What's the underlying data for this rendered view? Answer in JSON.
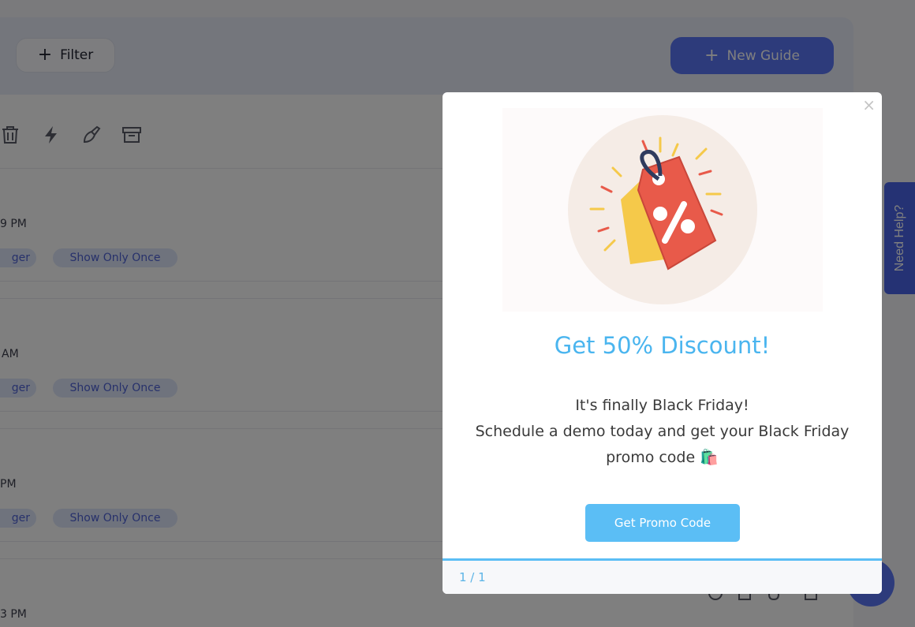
{
  "header": {
    "filter_label": "Filter",
    "new_guide_label": "New Guide"
  },
  "toolbar": {
    "icons": [
      "trash-icon",
      "bolt-icon",
      "paint-brush-icon",
      "archive-icon"
    ]
  },
  "guides": [
    {
      "time": "9 PM",
      "trigger_tag": "ger",
      "frequency_tag": "Show Only Once"
    },
    {
      "time": "AM",
      "trigger_tag": "ger",
      "frequency_tag": "Show Only Once"
    },
    {
      "time": "PM",
      "trigger_tag": "ger",
      "frequency_tag": "Show Only Once"
    },
    {
      "time": "3 PM"
    }
  ],
  "help_tab": {
    "label": "Need Help?"
  },
  "modal": {
    "close": "×",
    "title": "Get 50% Discount!",
    "body_line1": "It's finally Black Friday!",
    "body_line2": "Schedule a demo today and get your Black Friday",
    "body_line3": "promo code 🛍️",
    "button_label": "Get Promo Code",
    "pager": "1 / 1",
    "progress": 1.0
  },
  "colors": {
    "accent": "#5b76f7",
    "modal_accent": "#4ab5ef",
    "button": "#5bbef5",
    "tag_bg": "#dfe6fb",
    "tag_text": "#4f63d6"
  }
}
